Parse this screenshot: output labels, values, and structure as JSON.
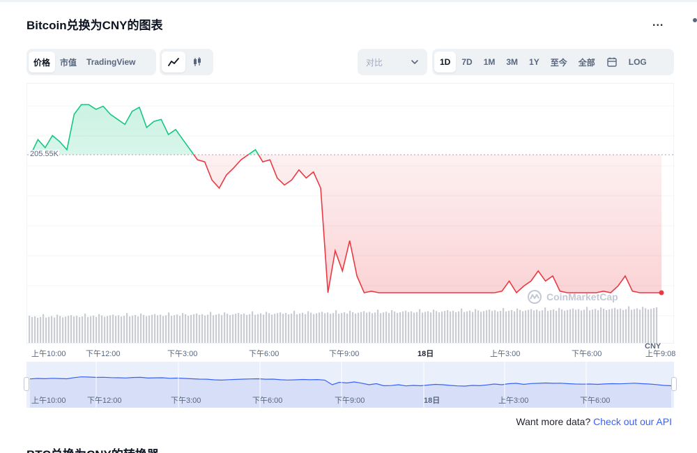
{
  "header": {
    "title": "Bitcoin兑换为CNY的图表",
    "more_label": "..."
  },
  "toolbar": {
    "type_tabs": [
      {
        "label": "价格",
        "active": true
      },
      {
        "label": "市值",
        "active": false
      },
      {
        "label": "TradingView",
        "active": false
      }
    ],
    "style_tabs": [
      {
        "icon": "line-chart-icon",
        "active": true
      },
      {
        "icon": "candlestick-icon",
        "active": false
      }
    ],
    "compare": {
      "label": "对比",
      "icon": "chevron-down-icon"
    },
    "range_tabs": [
      {
        "label": "1D",
        "active": true
      },
      {
        "label": "7D",
        "active": false
      },
      {
        "label": "1M",
        "active": false
      },
      {
        "label": "3M",
        "active": false
      },
      {
        "label": "1Y",
        "active": false
      },
      {
        "label": "至今",
        "active": false
      },
      {
        "label": "全部",
        "active": false
      },
      {
        "icon": "calendar-icon",
        "active": false
      },
      {
        "label": "LOG",
        "active": false
      }
    ]
  },
  "chart_data": {
    "type": "line",
    "title": "",
    "reference_value_label": "205.55K",
    "currency_label": "CNY",
    "colors": {
      "above": "#16c784",
      "below": "#ea3943",
      "volume": "#c9ccd3",
      "navigator": "#d6def8"
    },
    "x_tick_labels": [
      "上午10:00",
      "下午12:00",
      "下午3:00",
      "下午6:00",
      "下午9:00",
      "18日",
      "上午3:00",
      "下午6:00",
      "上午9:08"
    ],
    "navigator_tick_labels": [
      "上午10:00",
      "下午12:00",
      "下午3:00",
      "下午6:00",
      "下午9:00",
      "18日",
      "上午3:00",
      "下午6:00"
    ],
    "series": [
      {
        "values": [
          205.55,
          205.7,
          205.62,
          205.74,
          205.68,
          205.6,
          205.95,
          206.15,
          206.1,
          206.0,
          206.03,
          205.95,
          205.9,
          205.85,
          205.98,
          206.02,
          205.82,
          205.88,
          205.9,
          205.75,
          205.8,
          205.7,
          205.6,
          205.5,
          205.48,
          205.3,
          205.22,
          205.35,
          205.42,
          205.5,
          205.55,
          205.6,
          205.48,
          205.5,
          205.32,
          205.25,
          205.3,
          205.4,
          205.32,
          205.38,
          205.22,
          203.9,
          204.6,
          204.4,
          204.7,
          204.35,
          203.9,
          204.2,
          203.6,
          203.65,
          203.9,
          203.55,
          203.7,
          203.6,
          203.8,
          204.0,
          203.9,
          203.7,
          203.55,
          203.5,
          203.7,
          203.62,
          203.85,
          204.1,
          203.9,
          204.2,
          204.3,
          204.0,
          204.25,
          204.3,
          204.4,
          204.3,
          204.35,
          204.2,
          204.1,
          204.05,
          204.1,
          204.0,
          204.12,
          204.2,
          204.15,
          204.25,
          204.35,
          204.2,
          204.1,
          203.95,
          203.7,
          203.6
        ]
      }
    ]
  },
  "watermark": "CoinMarketCap",
  "footer": {
    "api_prefix": "Want more data?",
    "api_link": "Check out our API"
  },
  "next_section_title": "BTC兑换为CNY的转换器"
}
